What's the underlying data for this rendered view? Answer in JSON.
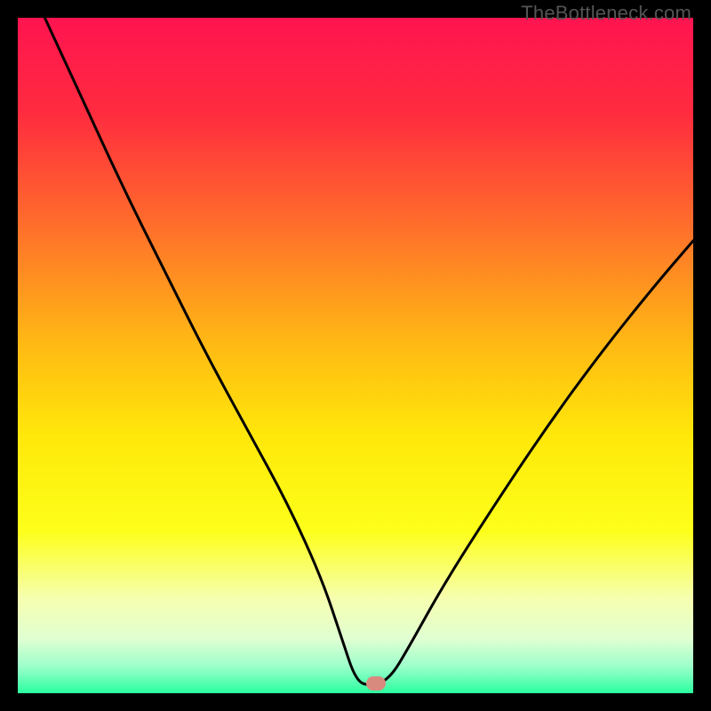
{
  "watermark": {
    "text": "TheBottleneck.com"
  },
  "gradient": {
    "stops": [
      {
        "pct": 0,
        "color": "#ff1450"
      },
      {
        "pct": 14,
        "color": "#ff2b3f"
      },
      {
        "pct": 30,
        "color": "#ff6b2c"
      },
      {
        "pct": 48,
        "color": "#ffb814"
      },
      {
        "pct": 62,
        "color": "#ffe80a"
      },
      {
        "pct": 76,
        "color": "#fdff1a"
      },
      {
        "pct": 86,
        "color": "#f6ffb0"
      },
      {
        "pct": 92,
        "color": "#e0ffd2"
      },
      {
        "pct": 96,
        "color": "#9dffcc"
      },
      {
        "pct": 100,
        "color": "#2aff9e"
      }
    ]
  },
  "marker": {
    "color": "#d98a7e",
    "x_frac": 0.53,
    "y_frac": 0.986
  },
  "chart_data": {
    "type": "line",
    "title": "",
    "xlabel": "",
    "ylabel": "",
    "xlim": [
      0,
      100
    ],
    "ylim": [
      0,
      100
    ],
    "series": [
      {
        "name": "bottleneck-curve",
        "x": [
          4,
          10,
          16,
          22,
          28,
          34,
          40,
          45,
          48,
          50,
          52,
          55,
          58,
          63,
          70,
          78,
          86,
          94,
          100
        ],
        "y": [
          100,
          87,
          74,
          62,
          50,
          39,
          28,
          17,
          8,
          2,
          1,
          2,
          7,
          16,
          27,
          39,
          50,
          60,
          67
        ]
      }
    ],
    "marker_point": {
      "x": 53,
      "y": 1
    }
  }
}
